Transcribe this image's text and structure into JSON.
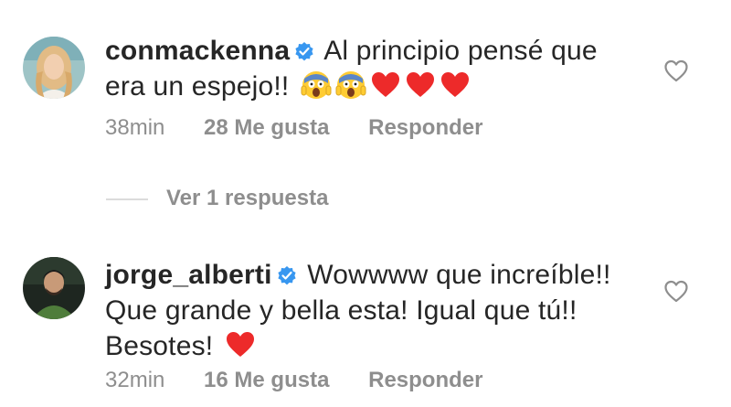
{
  "comments": [
    {
      "username": "conmackenna",
      "text": "Al principio pensé que era un espejo!!",
      "emojis": [
        "face-screaming-in-fear",
        "face-screaming-in-fear",
        "red-heart",
        "red-heart",
        "red-heart"
      ],
      "time": "38min",
      "likes": "28 Me gusta",
      "reply_label": "Responder"
    },
    {
      "username": "jorge_alberti",
      "text": "Wowwww que increíble!! Que grande y bella esta! Igual que tú!! Besotes!",
      "emojis": [
        "red-heart"
      ],
      "time": "32min",
      "likes": "16 Me gusta",
      "reply_label": "Responder"
    }
  ],
  "view_replies": "Ver 1 respuesta",
  "colors": {
    "text": "#262626",
    "muted": "#8e8e8e",
    "verified": "#3897f0",
    "heart": "#ed4956"
  }
}
